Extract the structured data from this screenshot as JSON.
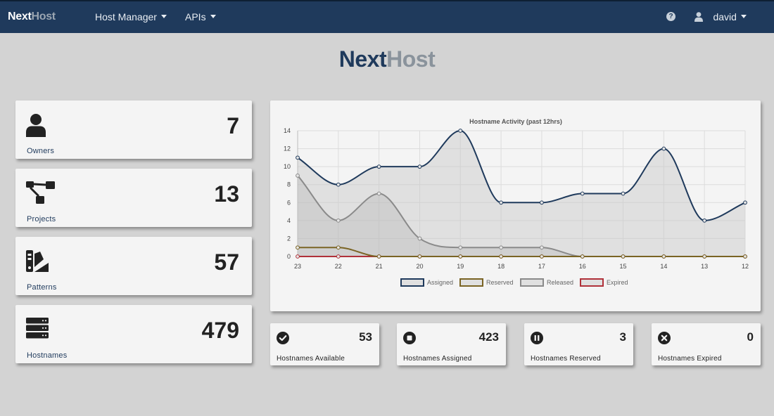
{
  "navbar": {
    "brand_part1": "Next",
    "brand_part2": "Host",
    "menu": [
      {
        "label": "Host Manager"
      },
      {
        "label": "APIs"
      }
    ],
    "help_symbol": "?",
    "user": "david"
  },
  "header": {
    "title_part1": "Next",
    "title_part2": "Host"
  },
  "stats": [
    {
      "icon": "user-icon",
      "value": "7",
      "label": "Owners"
    },
    {
      "icon": "sitemap-icon",
      "value": "13",
      "label": "Projects"
    },
    {
      "icon": "swatchbook-icon",
      "value": "57",
      "label": "Patterns"
    },
    {
      "icon": "server-icon",
      "value": "479",
      "label": "Hostnames"
    }
  ],
  "hostname_stats": [
    {
      "icon": "check-circle-icon",
      "value": "53",
      "label": "Hostnames Available"
    },
    {
      "icon": "stop-circle-icon",
      "value": "423",
      "label": "Hostnames Assigned"
    },
    {
      "icon": "pause-circle-icon",
      "value": "3",
      "label": "Hostnames Reserved"
    },
    {
      "icon": "times-circle-icon",
      "value": "0",
      "label": "Hostnames Expired"
    }
  ],
  "colors": {
    "navbar": "#1f3a5c",
    "assigned": "#1f3a5c",
    "reserved": "#7a6424",
    "released": "#8a8a8a",
    "expired": "#b0313a"
  },
  "chart_data": {
    "type": "line",
    "title": "Hostname Activity (past 12hrs)",
    "x": [
      "23",
      "22",
      "21",
      "20",
      "19",
      "18",
      "17",
      "16",
      "15",
      "14",
      "13",
      "12"
    ],
    "ylim": [
      0,
      14
    ],
    "yticks": [
      0,
      2,
      4,
      6,
      8,
      10,
      12,
      14
    ],
    "grid": true,
    "legend_position": "bottom",
    "series": [
      {
        "name": "Assigned",
        "values": [
          11,
          8,
          10,
          10,
          14,
          6,
          6,
          7,
          7,
          12,
          4,
          6
        ],
        "color": "#1f3a5c",
        "fill": "rgba(200,200,200,0.45)"
      },
      {
        "name": "Reserved",
        "values": [
          1,
          1,
          0,
          0,
          0,
          0,
          0,
          0,
          0,
          0,
          0,
          0
        ],
        "color": "#7a6424",
        "fill": "rgba(0,0,0,0)"
      },
      {
        "name": "Released",
        "values": [
          9,
          4,
          7,
          2,
          1,
          1,
          1,
          0,
          0,
          0,
          0,
          0
        ],
        "color": "#8a8a8a",
        "fill": "rgba(160,160,160,0.35)"
      },
      {
        "name": "Expired",
        "values": [
          0,
          0,
          0,
          0,
          0,
          0,
          0,
          0,
          0,
          0,
          0,
          0
        ],
        "color": "#b0313a",
        "fill": "rgba(0,0,0,0)"
      }
    ]
  }
}
